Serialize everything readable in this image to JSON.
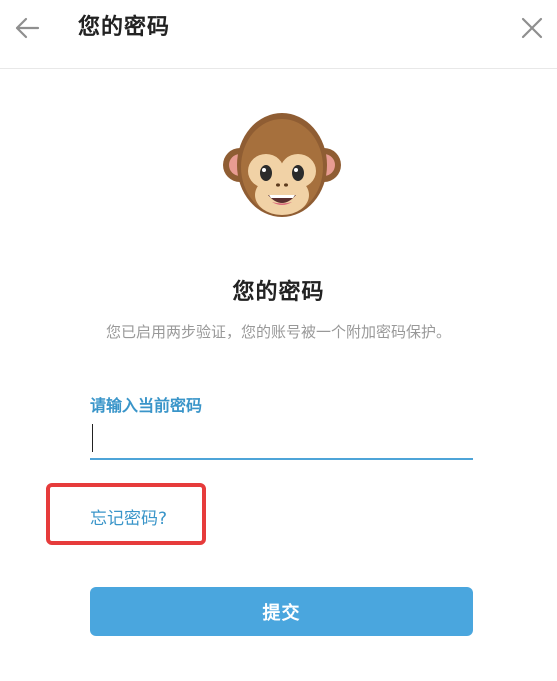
{
  "header": {
    "title": "您的密码",
    "back_icon": "arrow-left-icon",
    "close_icon": "close-icon"
  },
  "illustration": {
    "icon": "monkey-icon"
  },
  "main": {
    "title": "您的密码",
    "subtitle": "您已启用两步验证，您的账号被一个附加密码保护。"
  },
  "password_field": {
    "label": "请输入当前密码",
    "value": "",
    "placeholder": ""
  },
  "forgot_link": {
    "label": "忘记密码?"
  },
  "submit": {
    "label": "提交"
  },
  "colors": {
    "accent": "#4aa6de",
    "link": "#3a95c9",
    "highlight": "#e63b3b",
    "muted_text": "#999999"
  }
}
